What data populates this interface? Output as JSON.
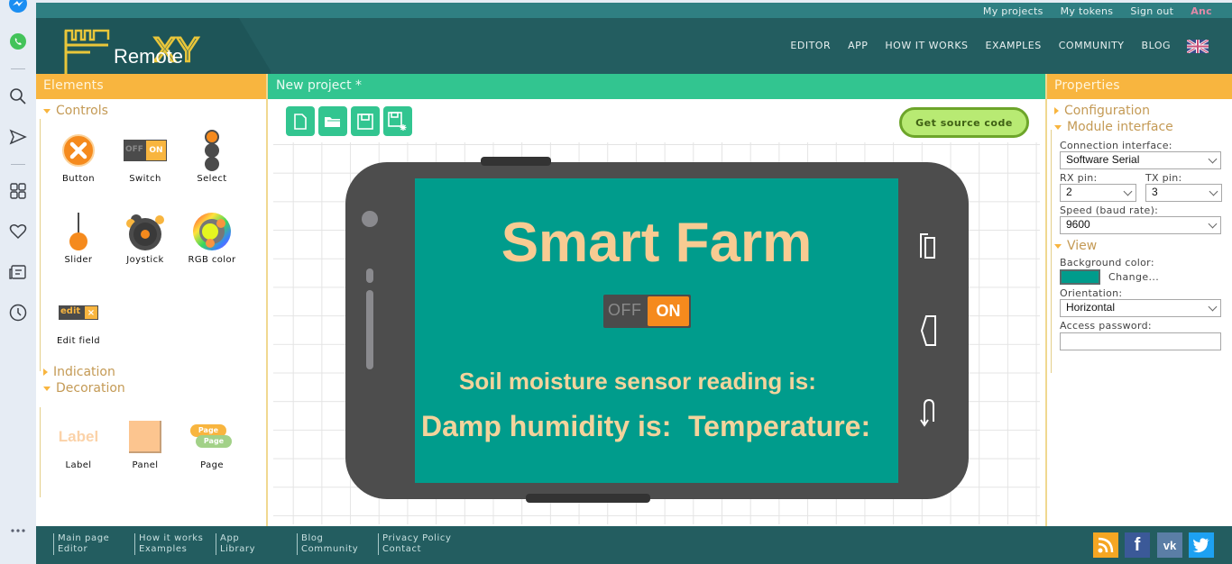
{
  "sidebar_icons": [
    "messenger-icon",
    "whatsapp-icon",
    "search-icon",
    "send-icon",
    "apps-icon",
    "heart-icon",
    "news-icon",
    "history-icon",
    "more-icon"
  ],
  "top_links": {
    "my_projects": "My projects",
    "my_tokens": "My tokens",
    "sign_out": "Sign out",
    "user": "Anc"
  },
  "logo": {
    "text": "Remote",
    "xy": "XY"
  },
  "nav": [
    "EDITOR",
    "APP",
    "HOW IT WORKS",
    "EXAMPLES",
    "COMMUNITY",
    "BLOG"
  ],
  "elements_panel": {
    "title": "Elements",
    "sections": {
      "controls": "Controls",
      "indication": "Indication",
      "decoration": "Decoration"
    },
    "controls": [
      {
        "label": "Button",
        "icon": "button-icon"
      },
      {
        "label": "Switch",
        "icon": "switch-icon"
      },
      {
        "label": "Select",
        "icon": "select-icon"
      },
      {
        "label": "Slider",
        "icon": "slider-icon"
      },
      {
        "label": "Joystick",
        "icon": "joystick-icon"
      },
      {
        "label": "RGB color",
        "icon": "rgb-color-icon"
      },
      {
        "label": "Edit field",
        "icon": "edit-field-icon"
      }
    ],
    "decoration": [
      {
        "label": "Label",
        "icon": "label-icon",
        "icon_text": "Label"
      },
      {
        "label": "Panel",
        "icon": "panel-icon"
      },
      {
        "label": "Page",
        "icon": "page-icon",
        "icon_text": "Page"
      }
    ],
    "switch_icon": {
      "off": "OFF",
      "on": "ON"
    },
    "edit_icon": {
      "text": "edit"
    }
  },
  "project": {
    "title": "New project *",
    "toolbar": [
      "new-file",
      "open-folder",
      "save",
      "save-as"
    ],
    "get_source": "Get source code"
  },
  "phone_screen": {
    "background": "#009c8c",
    "title": "Smart Farm",
    "switch": {
      "off": "OFF",
      "on": "ON"
    },
    "labels": {
      "soil": "Soil moisture sensor reading is:",
      "damp": "Damp humidity is:",
      "temp": "Temperature:"
    }
  },
  "properties": {
    "title": "Properties",
    "configuration": "Configuration",
    "module_interface": "Module interface",
    "connection_label": "Connection interface:",
    "connection_value": "Software Serial",
    "rx_label": "RX pin:",
    "rx_value": "2",
    "tx_label": "TX pin:",
    "tx_value": "3",
    "speed_label": "Speed (baud rate):",
    "speed_value": "9600",
    "view": "View",
    "bg_label": "Background color:",
    "bg_color": "#009c8c",
    "change": "Change...",
    "orientation_label": "Orientation:",
    "orientation_value": "Horizontal",
    "password_label": "Access password:",
    "password_value": ""
  },
  "footer": {
    "cols": [
      [
        "Main page",
        "Editor"
      ],
      [
        "How it works",
        "Examples"
      ],
      [
        "App",
        "Library"
      ],
      [
        "Blog",
        "Community"
      ],
      [
        "Privacy Policy",
        "Contact"
      ]
    ],
    "social": [
      "rss",
      "facebook",
      "vk",
      "twitter"
    ]
  }
}
